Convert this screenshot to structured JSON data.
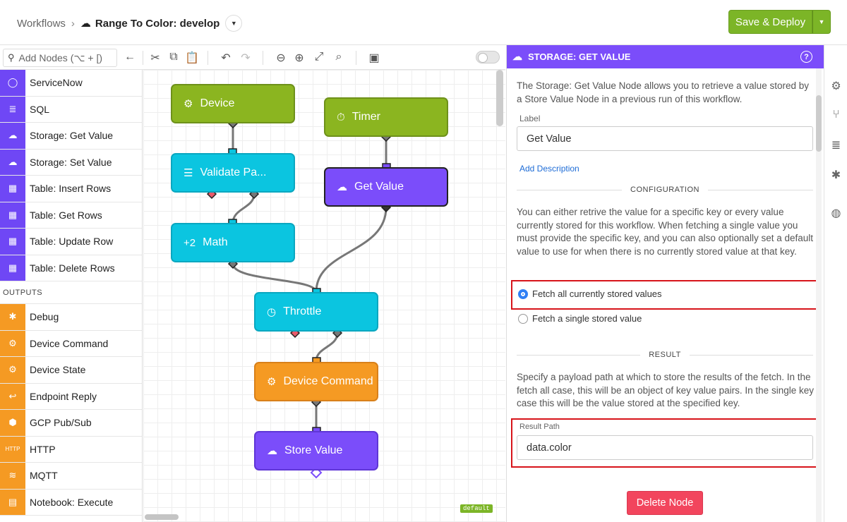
{
  "header": {
    "breadcrumb_root": "Workflows",
    "breadcrumb_sep": "›",
    "workflow_title": "Range To Color: develop",
    "deploy_label": "Save & Deploy"
  },
  "toolbar": {
    "search_placeholder": "Add Nodes (⌥ + [)"
  },
  "palette": {
    "items_top": [
      {
        "label": "ServiceNow",
        "icon": "servicenow-icon",
        "color": "#6f47f5"
      },
      {
        "label": "SQL",
        "icon": "database-icon",
        "color": "#6f47f5"
      },
      {
        "label": "Storage: Get Value",
        "icon": "cloud-download-icon",
        "color": "#6f47f5"
      },
      {
        "label": "Storage: Set Value",
        "icon": "cloud-upload-icon",
        "color": "#6f47f5"
      },
      {
        "label": "Table: Insert Rows",
        "icon": "table-icon",
        "color": "#6f47f5"
      },
      {
        "label": "Table: Get Rows",
        "icon": "table-icon",
        "color": "#6f47f5"
      },
      {
        "label": "Table: Update Row",
        "icon": "table-icon",
        "color": "#6f47f5"
      },
      {
        "label": "Table: Delete Rows",
        "icon": "table-icon",
        "color": "#6f47f5"
      }
    ],
    "outputs_heading": "OUTPUTS",
    "items_outputs": [
      {
        "label": "Debug",
        "icon": "bug-icon",
        "color": "#f59a23"
      },
      {
        "label": "Device Command",
        "icon": "chip-icon",
        "color": "#f59a23"
      },
      {
        "label": "Device State",
        "icon": "chip-icon",
        "color": "#f59a23"
      },
      {
        "label": "Endpoint Reply",
        "icon": "reply-icon",
        "color": "#f59a23"
      },
      {
        "label": "GCP Pub/Sub",
        "icon": "gcp-icon",
        "color": "#f59a23"
      },
      {
        "label": "HTTP",
        "icon": "http-icon",
        "color": "#f59a23"
      },
      {
        "label": "MQTT",
        "icon": "mqtt-icon",
        "color": "#f59a23"
      },
      {
        "label": "Notebook: Execute",
        "icon": "notebook-icon",
        "color": "#f59a23"
      }
    ]
  },
  "canvas": {
    "nodes": {
      "device": "Device",
      "timer": "Timer",
      "validate": "Validate Pa...",
      "get_value": "Get Value",
      "math": "Math",
      "throttle": "Throttle",
      "device_command": "Device Command",
      "store_value": "Store Value"
    },
    "math_icon_text": "+2",
    "version_badge": "default"
  },
  "panel": {
    "title": "STORAGE: GET VALUE",
    "intro": "The Storage: Get Value Node allows you to retrieve a value stored by a Store Value Node in a previous run of this workflow.",
    "label_caption": "Label",
    "label_value": "Get Value",
    "add_description": "Add Description",
    "configuration_heading": "CONFIGURATION",
    "configuration_text": "You can either retrive the value for a specific key or every value currently stored for this workflow. When fetching a single value you must provide the specific key, and you can also optionally set a default value to use for when there is no currently stored value at that key.",
    "radio_all": "Fetch all currently stored values",
    "radio_single": "Fetch a single stored value",
    "result_heading": "RESULT",
    "result_text": "Specify a payload path at which to store the results of the fetch. In the fetch all case, this will be an object of key value pairs. In the single key case this will be the value stored at the specified key.",
    "result_path_caption": "Result Path",
    "result_path_value": "data.color",
    "delete_label": "Delete Node"
  },
  "colors": {
    "accent_green": "#7cb527",
    "purple": "#7b4dfa",
    "cyan": "#0bc5e0",
    "orange": "#f59a23",
    "highlight_red": "#d7141a",
    "delete_red": "#f2455d"
  }
}
